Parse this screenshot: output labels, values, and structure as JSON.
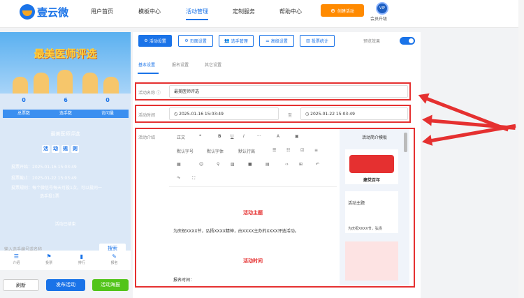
{
  "brand": {
    "name": "壹云微"
  },
  "nav": [
    "用户首页",
    "模板中心",
    "活动管理",
    "定制服务",
    "帮助中心"
  ],
  "create_btn": "创建活动",
  "vip": {
    "badge": "VIP",
    "label": "会员升级"
  },
  "preview": {
    "title": "最美医师评选",
    "stats": [
      {
        "value": "0",
        "label": "总票数"
      },
      {
        "value": "6",
        "label": "选手数"
      },
      {
        "value": "0",
        "label": "访问量"
      }
    ],
    "activity_name": "最美医师评选",
    "rules_chars": [
      "活",
      "动",
      "规",
      "则"
    ],
    "info": [
      "投票开始：2025-01-16 15:03:49",
      "投票截止：2025-01-22 15:03:49",
      "投票规则：每个微信号每天可投1次，可以投同一",
      "选手投1票"
    ],
    "ended": "活动已结束",
    "search_placeholder": "输入选手编号或名称",
    "vote_btn": "搜索",
    "tabs": [
      "介绍",
      "投票",
      "排行",
      "报名"
    ]
  },
  "bottom_buttons": {
    "refresh": "刷新",
    "publish": "发布活动",
    "poster": "活动海报"
  },
  "toolbar": [
    "活动设置",
    "页面设置",
    "选手管理",
    "高级设置",
    "投票统计"
  ],
  "preview_label": "预览效果",
  "subtabs": [
    "基本设置",
    "报名设置",
    "其它设置"
  ],
  "form": {
    "name_label": "活动名称 ⓘ",
    "name_value": "最美医师评选",
    "time_label": "活动时间",
    "start": "2025-01-16 15:03:49",
    "sep": "至",
    "end": "2025-01-22 15:03:49",
    "intro_label": "活动介绍"
  },
  "editor": {
    "tools_row1": [
      "正文",
      "❝",
      "B",
      "U",
      "I",
      "···",
      "A",
      "▣"
    ],
    "tools_row2": [
      "默认字号",
      "默认字体",
      "默认行高",
      "☰",
      "☷",
      "☑",
      "≡"
    ],
    "tools_row3": [
      "▦",
      "☺",
      "⚲",
      "▨",
      "■",
      "▤",
      "‹›",
      "⊞",
      "↶"
    ],
    "tools_row4": [
      "↷",
      "⛶"
    ],
    "h1": "活动主题",
    "p1": "为庆祝XXXX节，弘扬XXXX精神，由XXXX主办的XXXX评选活动。",
    "h2": "活动时间",
    "p2": "报名时间："
  },
  "template_panel": {
    "title": "活动简介模板",
    "card2": "活动主题",
    "card2_text": "为庆祝XXXX节，弘扬",
    "card1_text": "建党百年"
  }
}
